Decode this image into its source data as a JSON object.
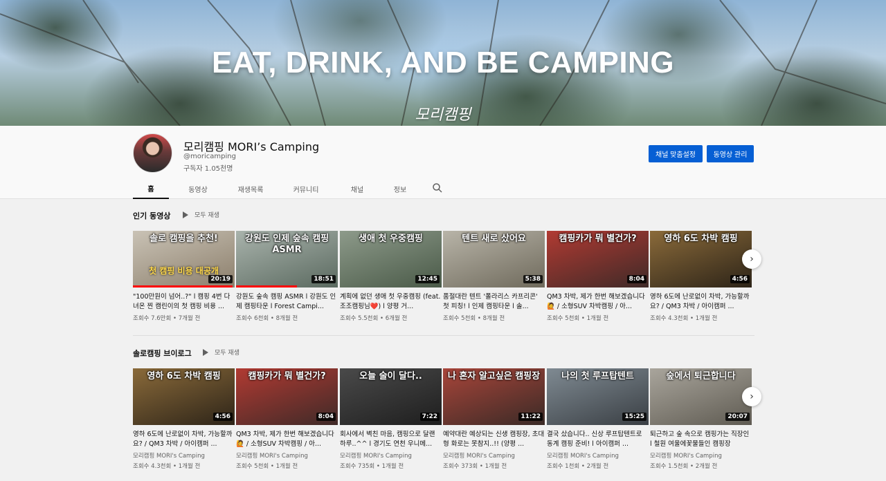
{
  "banner": {
    "title": "EAT, DRINK, AND BE CAMPING",
    "logo": "모리캠핑"
  },
  "channel": {
    "name": "모리캠핑 MORI’s Camping",
    "handle": "@moricamping",
    "subscribers": "구독자 1.05천명",
    "customize_label": "채널 맞춤설정",
    "manage_label": "동영상 관리"
  },
  "tabs": [
    {
      "label": "홈",
      "active": true
    },
    {
      "label": "동영상"
    },
    {
      "label": "재생목록"
    },
    {
      "label": "커뮤니티"
    },
    {
      "label": "채널"
    },
    {
      "label": "정보"
    }
  ],
  "shelves": [
    {
      "title": "인기 동영상",
      "play_all": "모두 재생",
      "videos": [
        {
          "thumb_text": "솔로 캠핑을 추천!",
          "thumb_sub": "첫 캠핑 비용 대공개",
          "duration": "20:19",
          "title": "\"100만원이 넘어..?\" l 캠핑 4번 다녀온 찐 캠린이의 첫 캠핑 비용 ...",
          "meta": "조회수 7.6만회 • 7개월 전",
          "progress": 0.98,
          "colors": [
            "#c9c2b5",
            "#8c7f6c"
          ]
        },
        {
          "thumb_text": "강원도 인제 숲속 캠핑 ASMR",
          "thumb_sub": "",
          "duration": "18:51",
          "title": "강원도 숲속 캠핑 ASMR l 강원도 인제 캠핑타운 l Forest Campi...",
          "meta": "조회수 6천회 • 8개월 전",
          "progress": 0.6,
          "colors": [
            "#a9b3ac",
            "#5b6a60"
          ]
        },
        {
          "thumb_text": "생애 첫 우중캠핑",
          "thumb_sub": "",
          "duration": "12:45",
          "title": "계획에 없던 생애 첫 우중캠핑 (feat. 조조캠핑님❤️) l 양평 거...",
          "meta": "조회수 5.5천회 • 6개월 전",
          "progress": 0.0,
          "colors": [
            "#8d9a8a",
            "#4a5a48"
          ]
        },
        {
          "thumb_text": "텐트 새로 샀어요",
          "thumb_sub": "",
          "duration": "5:38",
          "title": "품절대란 텐트 '폴라리스 카프리콘' 첫 피칭! l 인제 캠핑타운 l 솔...",
          "meta": "조회수 5천회 • 8개월 전",
          "progress": 0.0,
          "colors": [
            "#b8b4a8",
            "#6f6a5c"
          ]
        },
        {
          "thumb_text": "캠핑카가 뭐 별건가?",
          "thumb_sub": "",
          "duration": "8:04",
          "title": "QM3 차박, 제가 한번 해보겠습니다🙋 / 소형SUV 차박캠핑 / 아...",
          "meta": "조회수 5천회 • 1개월 전",
          "progress": 0.0,
          "colors": [
            "#b13a32",
            "#3f2a28"
          ]
        },
        {
          "thumb_text": "영하 6도 차박 캠핑",
          "thumb_sub": "",
          "duration": "4:56",
          "title": "영하 6도에 난로없이 차박, 가능할까요? / QM3 차박 / 아이캠퍼 ...",
          "meta": "조회수 4.3천회 • 1개월 전",
          "progress": 0.0,
          "colors": [
            "#8a6a3a",
            "#2d2418"
          ]
        }
      ]
    },
    {
      "title": "솔로캠핑 브이로그",
      "play_all": "모두 재생",
      "videos": [
        {
          "thumb_text": "영하 6도 차박 캠핑",
          "thumb_sub": "",
          "duration": "4:56",
          "title": "영하 6도에 난로없이 차박, 가능할까요? / QM3 차박 / 아이캠퍼 ...",
          "channel": "모리캠핑 MORI's Camping",
          "meta": "조회수 4.3천회 • 1개월 전",
          "progress": 0.0,
          "colors": [
            "#8a6a3a",
            "#2d2418"
          ]
        },
        {
          "thumb_text": "캠핑카가 뭐 별건가?",
          "thumb_sub": "",
          "duration": "8:04",
          "title": "QM3 차박, 제가 한번 해보겠습니다🙋 / 소형SUV 차박캠핑 / 아...",
          "channel": "모리캠핑 MORI's Camping",
          "meta": "조회수 5천회 • 1개월 전",
          "progress": 0.0,
          "colors": [
            "#b13a32",
            "#3f2a28"
          ]
        },
        {
          "thumb_text": "오늘 술이 달다..",
          "thumb_sub": "",
          "duration": "7:22",
          "title": "회사에서 벽친 마음, 캠핑으로 달랜 하루..^^ l 경기도 연천 우니메...",
          "channel": "모리캠핑 MORI's Camping",
          "meta": "조회수 735회 • 1개월 전",
          "progress": 0.0,
          "colors": [
            "#4a4a4a",
            "#1e1e1e"
          ]
        },
        {
          "thumb_text": "나 혼자 알고싶은 캠핑장",
          "thumb_sub": "",
          "duration": "11:22",
          "title": "예약대란 예상되는 신생 캠핑장, 초대형 화로는 못참지..!! (양평 ...",
          "channel": "모리캠핑 MORI's Camping",
          "meta": "조회수 373회 • 1개월 전",
          "progress": 0.0,
          "colors": [
            "#a8453a",
            "#3a2a26"
          ]
        },
        {
          "thumb_text": "나의 첫 루프탑텐트",
          "thumb_sub": "",
          "duration": "15:25",
          "title": "결국 샀습니다.. 신상 루프탑텐트로 동계 캠핑 준비! l 아이캠퍼 ...",
          "channel": "모리캠핑 MORI's Camping",
          "meta": "조회수 1천회 • 2개월 전",
          "progress": 0.0,
          "colors": [
            "#7f8a92",
            "#3a3f44"
          ]
        },
        {
          "thumb_text": "숲에서 퇴근합니다",
          "thumb_sub": "",
          "duration": "20:07",
          "title": "퇴근하고 숲 속으로 캠핑가는 직장인 l 철원 여울에꽃물들인 캠핑장",
          "channel": "모리캠핑 MORI's Camping",
          "meta": "조회수 1.5천회 • 2개월 전",
          "progress": 0.0,
          "colors": [
            "#a9a59c",
            "#5f5b52"
          ]
        }
      ]
    }
  ]
}
